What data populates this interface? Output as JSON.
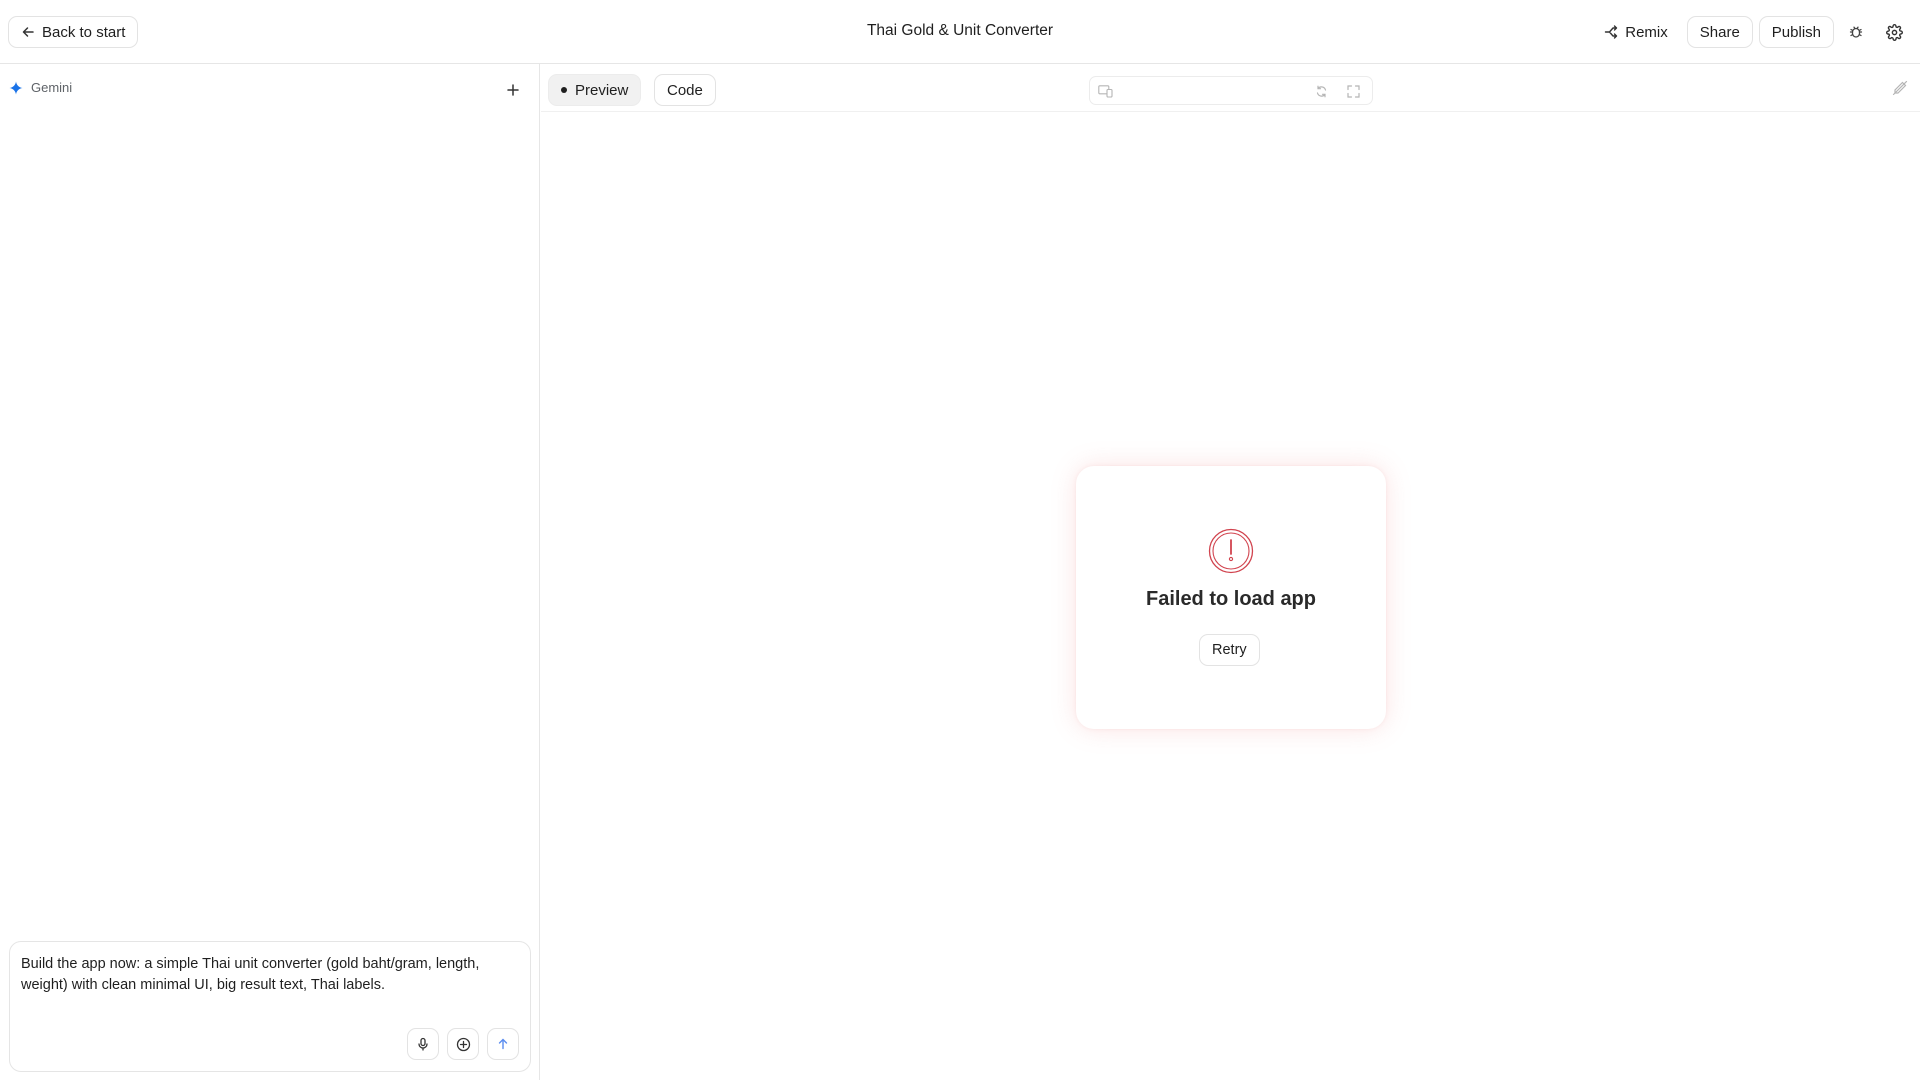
{
  "header": {
    "back_label": "Back to start",
    "title": "Thai Gold & Unit Converter",
    "remix_label": "Remix",
    "share_label": "Share",
    "publish_label": "Publish",
    "icons": [
      "arrow-left-icon",
      "remix-icon",
      "bug-icon",
      "gear-icon"
    ]
  },
  "sidebar": {
    "model_name": "Gemini",
    "model_icon_color": "#1a73e8",
    "composer": {
      "text": "Build the app now: a simple Thai unit converter (gold baht/gram, length, weight) with clean minimal UI, big result text, Thai labels."
    },
    "icons": [
      "sparkle-icon",
      "plus-icon",
      "mic-icon",
      "add-circle-icon",
      "send-arrow-icon"
    ]
  },
  "main": {
    "tabs": [
      {
        "label": "Preview",
        "active": true
      },
      {
        "label": "Code",
        "active": false
      }
    ],
    "error": {
      "title": "Failed to load app",
      "retry_label": "Retry",
      "accent_color": "#d1434e"
    },
    "icons": [
      "device-icon",
      "reload-icon",
      "fullscreen-icon",
      "edit-off-icon",
      "error-circle-icon"
    ]
  }
}
